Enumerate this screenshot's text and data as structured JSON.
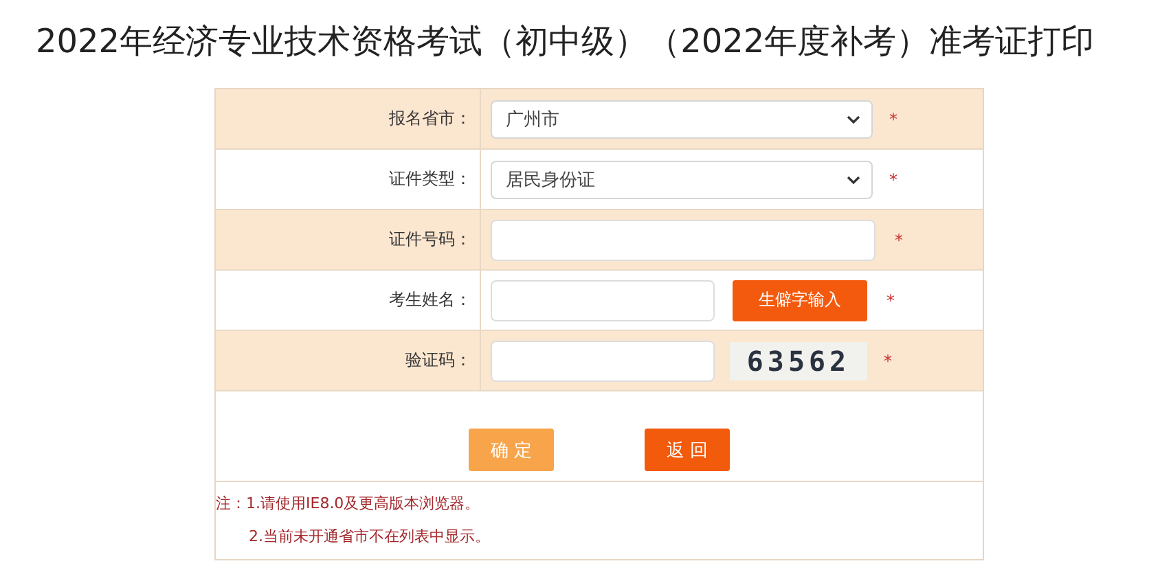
{
  "title": "2022年经济专业技术资格考试（初中级）（2022年度补考）准考证打印",
  "fields": [
    {
      "kind": "select",
      "label": "报名省市：",
      "value": "广州市",
      "required": "*"
    },
    {
      "kind": "select",
      "label": "证件类型：",
      "value": "居民身份证",
      "required": "*"
    },
    {
      "kind": "input",
      "label": "证件号码：",
      "required": "*"
    },
    {
      "kind": "name",
      "label": "考生姓名：",
      "button": "生僻字输入",
      "required": "*"
    },
    {
      "kind": "captcha",
      "label": "验证码：",
      "captcha": "63562",
      "required": "*"
    }
  ],
  "buttons": [
    {
      "label": "确 定",
      "kind": "primary"
    },
    {
      "label": "返 回",
      "kind": "secondary"
    }
  ],
  "notes": [
    "注：1.请使用IE8.0及更高版本浏览器。",
    "2.当前未开通省市不在列表中显示。"
  ]
}
